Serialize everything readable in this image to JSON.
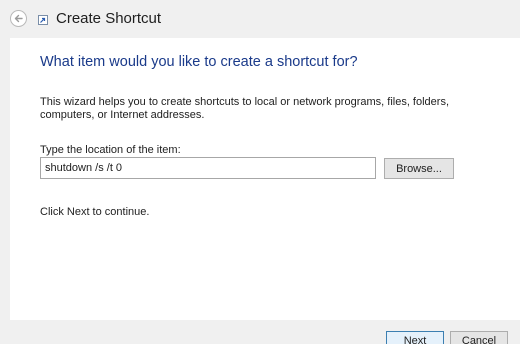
{
  "window": {
    "title": "Create Shortcut"
  },
  "icons": {
    "back": "back-arrow-icon",
    "app": "shortcut-icon"
  },
  "main": {
    "heading": "What item would you like to create a shortcut for?",
    "description": "This wizard helps you to create shortcuts to local or network programs, files, folders, computers, or Internet addresses.",
    "location_label": "Type the location of the item:",
    "location_value": "shutdown /s /t 0",
    "browse_label": "Browse...",
    "continue_text": "Click Next to continue."
  },
  "footer": {
    "next_label": "Next",
    "cancel_label": "Cancel"
  },
  "colors": {
    "heading": "#1a3a8a",
    "chrome": "#f0f0f0",
    "default_button_border": "#3c7fb1"
  }
}
